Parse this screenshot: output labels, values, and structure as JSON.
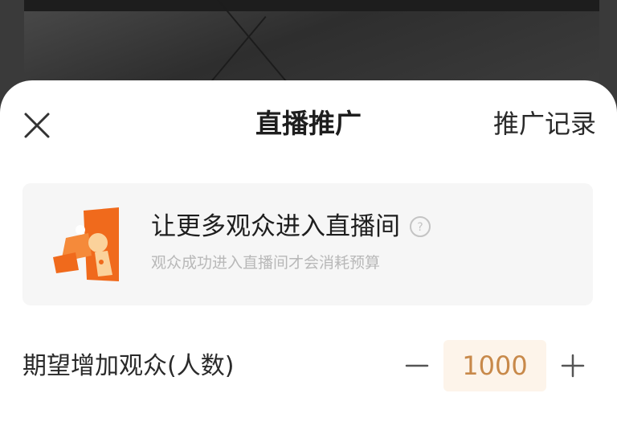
{
  "sheet": {
    "title": "直播推广",
    "close_icon": "close-icon",
    "record_link": "推广记录"
  },
  "promo": {
    "headline": "让更多观众进入直播间",
    "help_icon": "help-icon",
    "subtext": "观众成功进入直播间才会消耗预算",
    "icon": "promo-rocket-icon",
    "accent_color": "#f06a1c"
  },
  "audience": {
    "label": "期望增加观众(人数)",
    "value": "1000",
    "minus_icon": "minus-icon",
    "plus_icon": "plus-icon",
    "value_bg": "#fdf4ea",
    "value_color": "#c8894a"
  }
}
